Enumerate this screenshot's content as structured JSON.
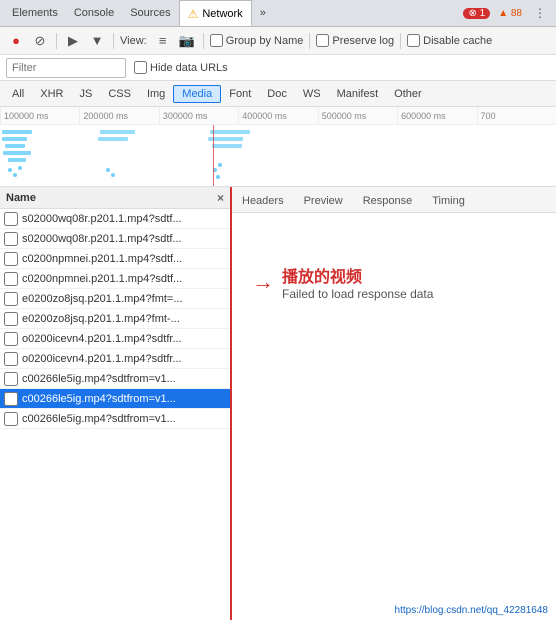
{
  "tabs": {
    "items": [
      {
        "label": "Elements",
        "active": false,
        "icon": ""
      },
      {
        "label": "Console",
        "active": false,
        "icon": ""
      },
      {
        "label": "Sources",
        "active": false,
        "icon": ""
      },
      {
        "label": "Network",
        "active": true,
        "icon": "⚠"
      },
      {
        "label": "»",
        "active": false,
        "icon": ""
      }
    ],
    "badges": {
      "error": "⊗ 1",
      "warning": "▲ 88"
    },
    "more_icon": "⋮"
  },
  "toolbar": {
    "record_label": "●",
    "clear_label": "⊘",
    "video_label": "▶",
    "filter_label": "▼",
    "view_label": "View:",
    "list_icon": "≡",
    "screenshot_icon": "📷",
    "group_by_name": "Group by Name",
    "preserve_log": "Preserve log",
    "disable_cache": "Disable cache"
  },
  "filter": {
    "placeholder": "Filter",
    "hide_data_urls": "Hide data URLs"
  },
  "type_tabs": {
    "items": [
      {
        "label": "All",
        "active": false
      },
      {
        "label": "XHR",
        "active": false
      },
      {
        "label": "JS",
        "active": false
      },
      {
        "label": "CSS",
        "active": false
      },
      {
        "label": "Img",
        "active": false
      },
      {
        "label": "Media",
        "active": true
      },
      {
        "label": "Font",
        "active": false
      },
      {
        "label": "Doc",
        "active": false
      },
      {
        "label": "WS",
        "active": false
      },
      {
        "label": "Manifest",
        "active": false
      },
      {
        "label": "Other",
        "active": false
      }
    ]
  },
  "timeline": {
    "ticks": [
      "100000 ms",
      "200000 ms",
      "300000 ms",
      "400000 ms",
      "500000 ms",
      "600000 ms",
      "700"
    ]
  },
  "request_list": {
    "header": "Name",
    "close_label": "×",
    "items": [
      {
        "name": "s02000wq08r.p201.1.mp4?sdtf...",
        "selected": false,
        "checked": false
      },
      {
        "name": "s02000wq08r.p201.1.mp4?sdtf...",
        "selected": false,
        "checked": false
      },
      {
        "name": "c0200npmnei.p201.1.mp4?sdtf...",
        "selected": false,
        "checked": false
      },
      {
        "name": "c0200npmnei.p201.1.mp4?sdtf...",
        "selected": false,
        "checked": false
      },
      {
        "name": "e0200zo8jsq.p201.1.mp4?fmt=...",
        "selected": false,
        "checked": false
      },
      {
        "name": "e0200zo8jsq.p201.1.mp4?fmt-...",
        "selected": false,
        "checked": false
      },
      {
        "name": "o0200icevn4.p201.1.mp4?sdtfr...",
        "selected": false,
        "checked": false
      },
      {
        "name": "o0200icevn4.p201.1.mp4?sdtfr...",
        "selected": false,
        "checked": false
      },
      {
        "name": "c00266le5ig.mp4?sdtfrom=v1...",
        "selected": false,
        "checked": false
      },
      {
        "name": "c00266le5ig.mp4?sdtfrom=v1...",
        "selected": true,
        "checked": false
      },
      {
        "name": "c00266le5ig.mp4?sdtfrom=v1...",
        "selected": false,
        "checked": false
      }
    ]
  },
  "detail_panel": {
    "tabs": [
      {
        "label": "Headers",
        "active": false
      },
      {
        "label": "Preview",
        "active": false
      },
      {
        "label": "Response",
        "active": false
      },
      {
        "label": "Timing",
        "active": false
      }
    ],
    "content": "Failed to load response data"
  },
  "annotation": {
    "arrow": "→",
    "chinese": "播放的视频",
    "english": "Failed to load response data"
  },
  "bottom_status": {
    "url": "https://blog.csdn.net/qq_42281648"
  }
}
